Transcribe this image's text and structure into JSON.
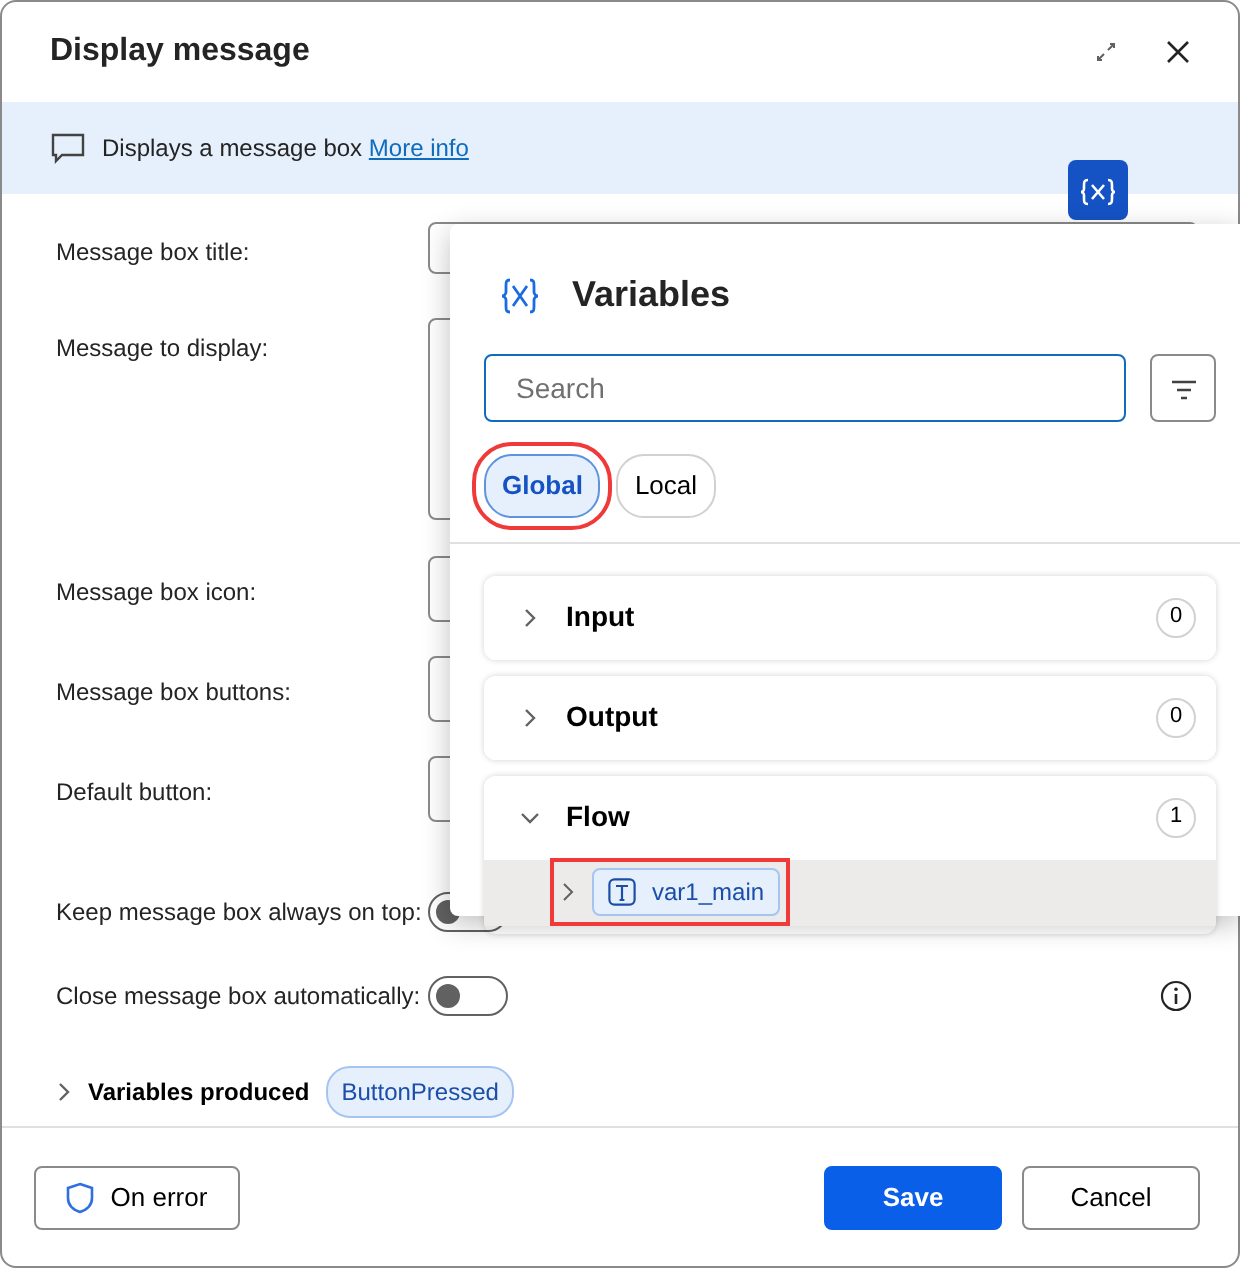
{
  "dialog": {
    "title": "Display message",
    "info": {
      "text": "Displays a message box",
      "link": "More info"
    },
    "fields": [
      {
        "kind": "text",
        "label": "Message box title:"
      },
      {
        "kind": "textarea",
        "label": "Message to display:"
      },
      {
        "kind": "select",
        "label": "Message box icon:"
      },
      {
        "kind": "select",
        "label": "Message box buttons:"
      },
      {
        "kind": "select",
        "label": "Default button:"
      },
      {
        "kind": "toggle",
        "label": "Keep message box always on top:",
        "on": false
      },
      {
        "kind": "toggle",
        "label": "Close message box automatically:",
        "on": false,
        "info": true
      }
    ],
    "variables_produced": {
      "label": "Variables produced",
      "chips": [
        "ButtonPressed"
      ]
    },
    "footer": {
      "on_error": "On error",
      "save": "Save",
      "cancel": "Cancel"
    }
  },
  "variables_panel": {
    "title": "Variables",
    "search": {
      "placeholder": "Search"
    },
    "scopes": [
      {
        "label": "Global",
        "selected": true,
        "highlighted": true
      },
      {
        "label": "Local",
        "selected": false,
        "highlighted": false
      }
    ],
    "groups": [
      {
        "name": "Input",
        "count": "0",
        "expanded": false
      },
      {
        "name": "Output",
        "count": "0",
        "expanded": false
      },
      {
        "name": "Flow",
        "count": "1",
        "expanded": true,
        "variables": [
          {
            "name": "var1_main",
            "highlighted": true
          }
        ]
      }
    ]
  }
}
